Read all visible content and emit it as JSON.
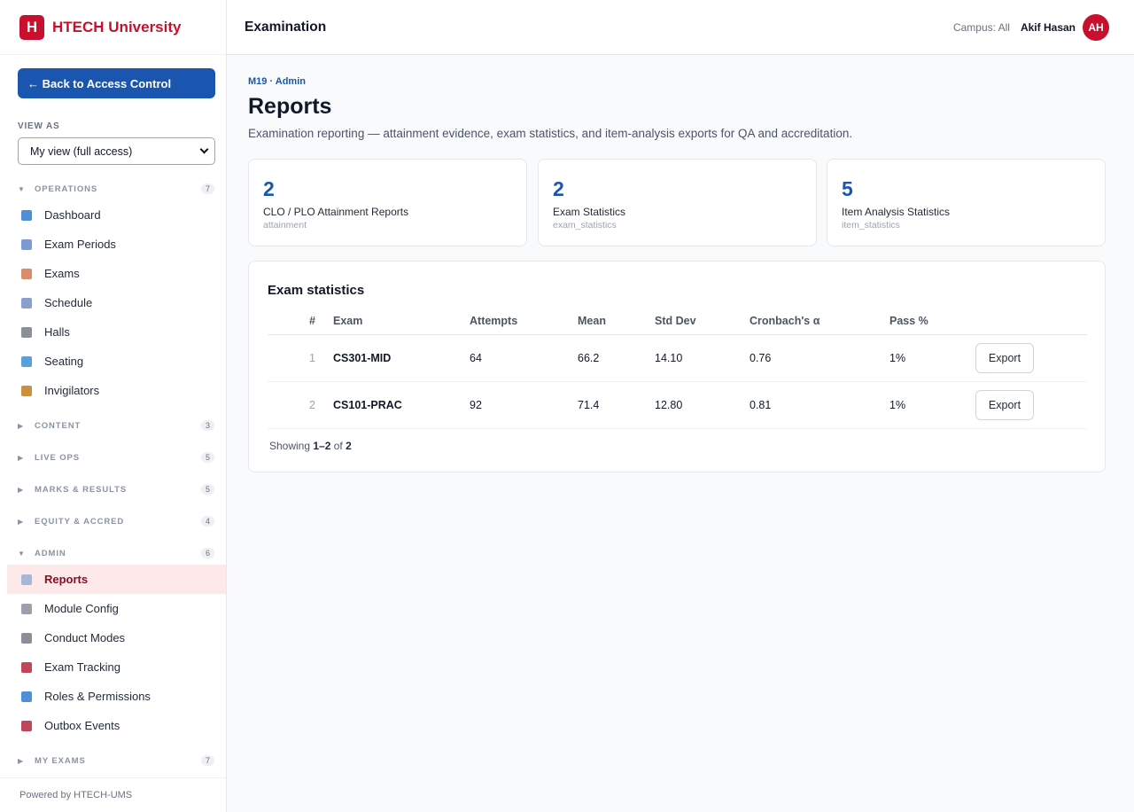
{
  "brand": {
    "logo_letter": "H",
    "name": "HTECH University"
  },
  "sidebar": {
    "back_label": "← Back to Access Control",
    "view_as_label": "VIEW AS",
    "view_as_value": "My view (full access)",
    "groups": [
      {
        "label": "OPERATIONS",
        "count": "7",
        "expanded": true,
        "items": [
          {
            "label": "Dashboard",
            "icon": "bar-chart-icon",
            "color": "#4f8fd8"
          },
          {
            "label": "Exam Periods",
            "icon": "calendar-icon",
            "color": "#7b9ad6"
          },
          {
            "label": "Exams",
            "icon": "clipboard-icon",
            "color": "#d98b6c"
          },
          {
            "label": "Schedule",
            "icon": "calendar-icon",
            "color": "#8a9fc9"
          },
          {
            "label": "Halls",
            "icon": "building-icon",
            "color": "#8b8f98"
          },
          {
            "label": "Seating",
            "icon": "seat-icon",
            "color": "#5aa0d8"
          },
          {
            "label": "Invigilators",
            "icon": "person-icon",
            "color": "#c9913f"
          }
        ]
      },
      {
        "label": "CONTENT",
        "count": "3",
        "expanded": false,
        "items": []
      },
      {
        "label": "LIVE OPS",
        "count": "5",
        "expanded": false,
        "items": []
      },
      {
        "label": "MARKS & RESULTS",
        "count": "5",
        "expanded": false,
        "items": []
      },
      {
        "label": "EQUITY & ACCRED",
        "count": "4",
        "expanded": false,
        "items": []
      },
      {
        "label": "ADMIN",
        "count": "6",
        "expanded": true,
        "items": [
          {
            "label": "Reports",
            "icon": "report-icon",
            "color": "#a9b7d6",
            "active": true
          },
          {
            "label": "Module Config",
            "icon": "gear-icon",
            "color": "#9aa1ab"
          },
          {
            "label": "Conduct Modes",
            "icon": "building-icon",
            "color": "#8b8f98"
          },
          {
            "label": "Exam Tracking",
            "icon": "inbox-icon",
            "color": "#c0475a"
          },
          {
            "label": "Roles & Permissions",
            "icon": "shield-icon",
            "color": "#4f8fd8"
          },
          {
            "label": "Outbox Events",
            "icon": "outbox-icon",
            "color": "#c0475a"
          }
        ]
      },
      {
        "label": "MY EXAMS",
        "count": "7",
        "expanded": false,
        "items": []
      }
    ],
    "powered_by": "Powered by HTECH-UMS"
  },
  "topbar": {
    "title": "Examination",
    "campus": "Campus: All",
    "user_name": "Akif Hasan",
    "avatar_initials": "AH"
  },
  "page": {
    "breadcrumb": "M19 · Admin",
    "title": "Reports",
    "subtitle": "Examination reporting — attainment evidence, exam statistics, and item-analysis exports for QA and accreditation."
  },
  "stats": [
    {
      "value": "2",
      "label": "CLO / PLO Attainment Reports",
      "key": "attainment"
    },
    {
      "value": "2",
      "label": "Exam Statistics",
      "key": "exam_statistics"
    },
    {
      "value": "5",
      "label": "Item Analysis Statistics",
      "key": "item_statistics"
    }
  ],
  "table": {
    "title": "Exam statistics",
    "columns": {
      "idx": "#",
      "exam": "Exam",
      "attempts": "Attempts",
      "mean": "Mean",
      "std": "Std Dev",
      "cronbach": "Cronbach's α",
      "pass": "Pass %"
    },
    "rows": [
      {
        "idx": "1",
        "exam": "CS301-MID",
        "attempts": "64",
        "mean": "66.2",
        "std": "14.10",
        "cronbach": "0.76",
        "pass": "1%",
        "action": "Export"
      },
      {
        "idx": "2",
        "exam": "CS101-PRAC",
        "attempts": "92",
        "mean": "71.4",
        "std": "12.80",
        "cronbach": "0.81",
        "pass": "1%",
        "action": "Export"
      }
    ],
    "footer": {
      "prefix": "Showing ",
      "range": "1–2",
      "mid": " of ",
      "total": "2"
    }
  }
}
